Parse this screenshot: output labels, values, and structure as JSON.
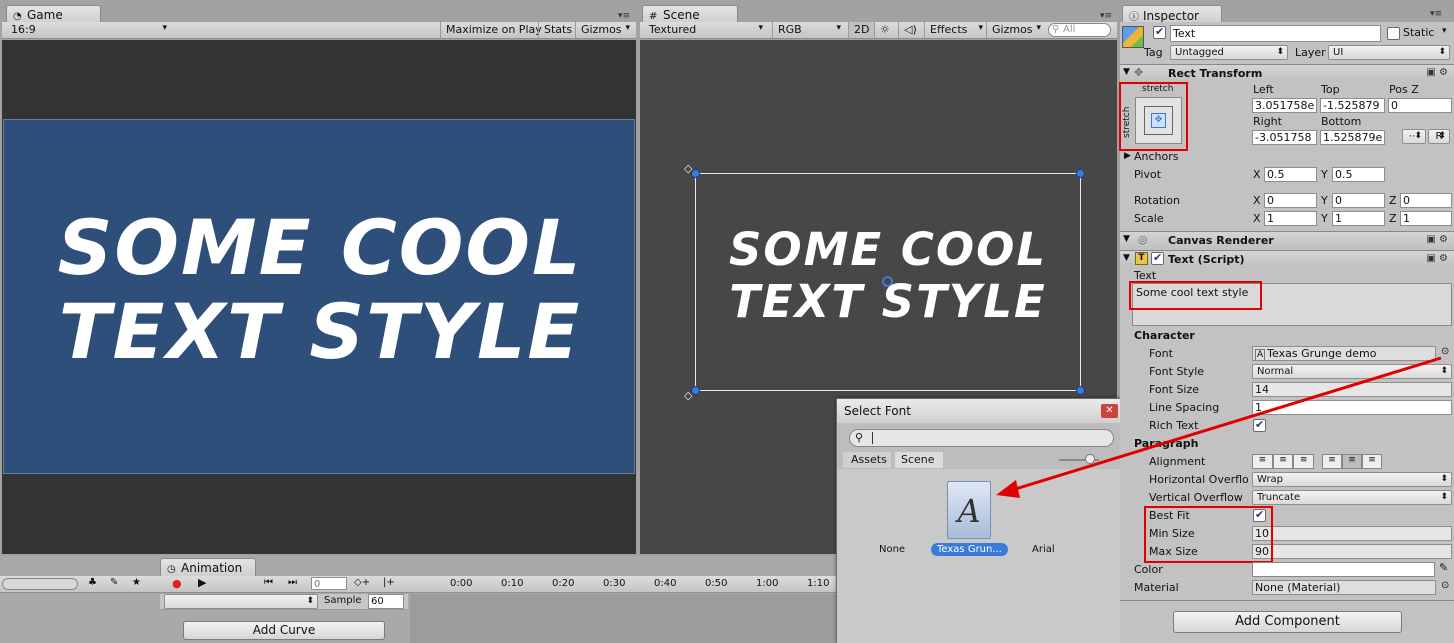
{
  "game": {
    "tab_label": "Game",
    "aspect": "16:9",
    "maximize": "Maximize on Play",
    "stats": "Stats",
    "gizmos": "Gizmos",
    "text_line1": "SOME COOL",
    "text_line2": "TEXT STYLE"
  },
  "scene": {
    "tab_label": "Scene",
    "draw_mode": "Textured",
    "color_mode": "RGB",
    "mode_2d": "2D",
    "effects": "Effects",
    "gizmos": "Gizmos",
    "search_placeholder": "All",
    "text_line1": "SOME COOL",
    "text_line2": "TEXT STYLE"
  },
  "inspector": {
    "tab_label": "Inspector",
    "object_name": "Text",
    "static_label": "Static",
    "tag_label": "Tag",
    "tag_value": "Untagged",
    "layer_label": "Layer",
    "layer_value": "UI",
    "rect_transform": {
      "title": "Rect Transform",
      "anchor_h": "stretch",
      "anchor_v": "stretch",
      "left_label": "Left",
      "top_label": "Top",
      "posz_label": "Pos Z",
      "left": "3.051758e",
      "top": "-1.525879",
      "posz": "0",
      "right_label": "Right",
      "bottom_label": "Bottom",
      "right": "-3.051758",
      "bottom": "1.525879e",
      "raw_btn": "R",
      "anchors_label": "Anchors",
      "pivot_label": "Pivot",
      "pivot_x": "0.5",
      "pivot_y": "0.5",
      "rotation_label": "Rotation",
      "rot_x": "0",
      "rot_y": "0",
      "rot_z": "0",
      "scale_label": "Scale",
      "scale_x": "1",
      "scale_y": "1",
      "scale_z": "1",
      "x": "X",
      "y": "Y",
      "z": "Z"
    },
    "canvas_renderer": {
      "title": "Canvas Renderer"
    },
    "text_script": {
      "title": "Text (Script)",
      "text_label": "Text",
      "text_value": "Some cool text style",
      "character_label": "Character",
      "font_label": "Font",
      "font_value": "Texas Grunge demo",
      "font_style_label": "Font Style",
      "font_style_value": "Normal",
      "font_size_label": "Font Size",
      "font_size_value": "14",
      "line_spacing_label": "Line Spacing",
      "line_spacing_value": "1",
      "rich_text_label": "Rich Text",
      "paragraph_label": "Paragraph",
      "alignment_label": "Alignment",
      "h_overflow_label": "Horizontal Overflo",
      "h_overflow_value": "Wrap",
      "v_overflow_label": "Vertical Overflow",
      "v_overflow_value": "Truncate",
      "best_fit_label": "Best Fit",
      "min_size_label": "Min Size",
      "min_size_value": "10",
      "max_size_label": "Max Size",
      "max_size_value": "90",
      "color_label": "Color",
      "material_label": "Material",
      "material_value": "None (Material)"
    },
    "add_component": "Add Component"
  },
  "select_font": {
    "title": "Select Font",
    "tab_assets": "Assets",
    "tab_scene": "Scene",
    "items": [
      "None",
      "Texas Grun...",
      "Arial"
    ],
    "font_glyph": "A"
  },
  "animation": {
    "tab_label": "Animation",
    "frame": "0",
    "sample_label": "Sample",
    "sample_value": "60",
    "add_curve": "Add Curve",
    "ticks": [
      "0:00",
      "0:10",
      "0:20",
      "0:30",
      "0:40",
      "0:50",
      "1:00",
      "1:10"
    ]
  },
  "colors": {
    "game_bg": "#2f4f7b",
    "scene_bg": "#474747",
    "highlight": "#e00000",
    "selection": "#3b7bd8"
  }
}
